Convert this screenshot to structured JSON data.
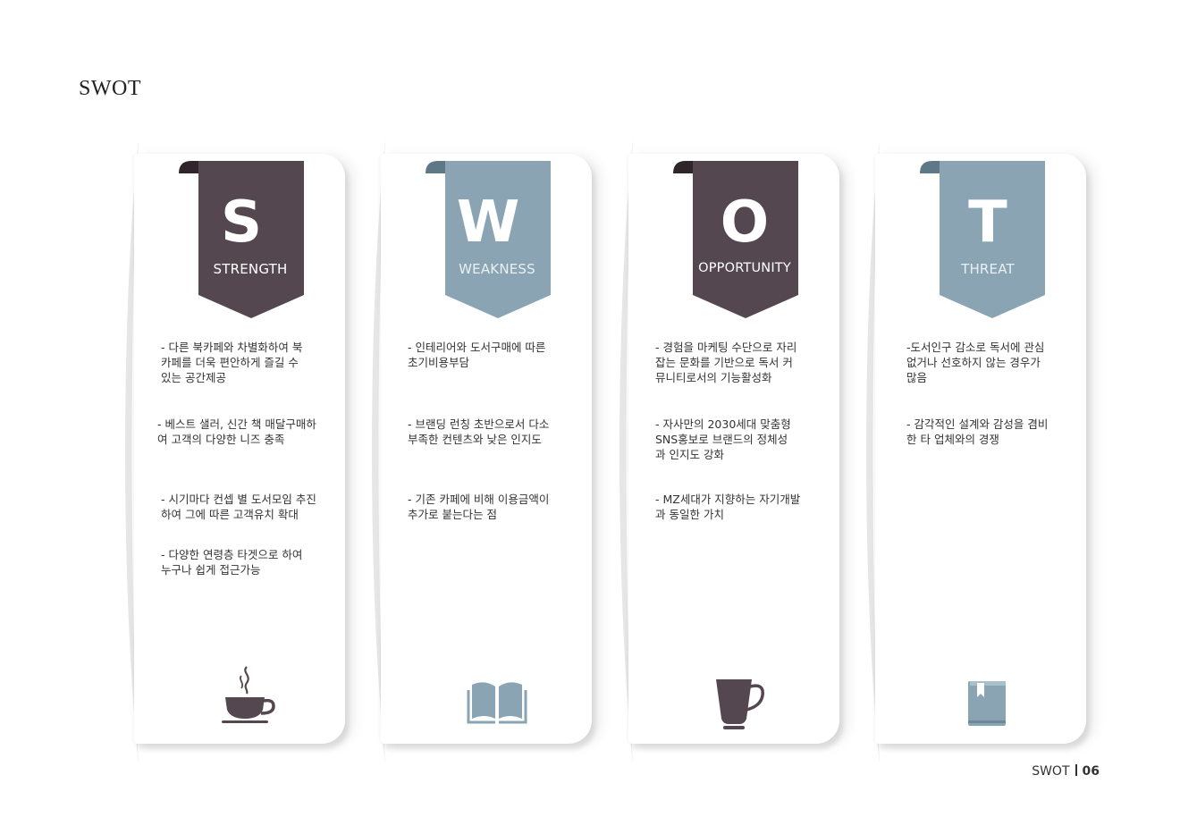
{
  "page": {
    "title": "SWOT",
    "footer_label": "SWOT",
    "footer_page": "06"
  },
  "colors": {
    "dark": "#54474f",
    "light": "#8aa4b3"
  },
  "columns": [
    {
      "letter": "S",
      "label": "STRENGTH",
      "icon": "coffee-cup-icon",
      "items": [
        "- 다른 북카페와  차별화하여 북\n  카페를 더욱 편안하게 즐길 수\n  있는 공간제공",
        "-  베스트 샐러, 신간 책 매달구매하\n   여 고객의 다양한 니즈 충족",
        "-  시기마다 컨셉 별 도서모임 추진\n   하여 그에 따른 고객유치 확대",
        "-  다양한 연령층 타겟으로 하여\n   누구나 쉽게 접근가능"
      ]
    },
    {
      "letter": "W",
      "label": "WEAKNESS",
      "icon": "open-book-icon",
      "items": [
        "- 인테리어와 도서구매에 따른\n  초기비용부담",
        "- 브랜딩 런칭 초반으로서 다소\n  부족한 컨텐츠와 낮은 인지도",
        "- 기존 카페에 비해 이용금액이\n  추가로 붙는다는 점"
      ]
    },
    {
      "letter": "O",
      "label": "OPPORTUNITY",
      "icon": "teacup-icon",
      "items": [
        "- 경험을 마케팅 수단으로 자리\n  잡는 문화를 기반으로 독서 커\n  뮤니티로서의 기능활성화",
        "- 자사만의 2030세대 맞춤형\n  SNS홍보로  브랜드의 정체성\n  과 인지도 강화",
        "- MZ세대가 지향하는 자기개발\n  과 동일한 가치"
      ]
    },
    {
      "letter": "T",
      "label": "THREAT",
      "icon": "closed-book-icon",
      "items": [
        "-도서인구 감소로 독서에 관심\n 없거나 선호하지 않는 경우가\n많음",
        "- 감각적인 설계와 감성을 겸비\n한 타 업체와의 경쟁"
      ]
    }
  ]
}
